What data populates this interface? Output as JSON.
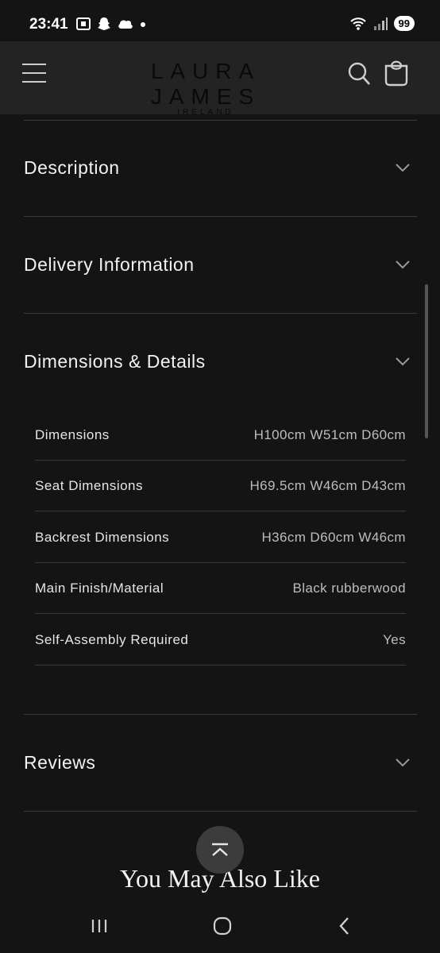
{
  "status_bar": {
    "time": "23:41",
    "battery": "99",
    "icons_left": [
      "screenshot-icon",
      "snapchat-icon",
      "cloud-icon",
      "dot-icon"
    ],
    "icons_right": [
      "wifi-icon",
      "signal-icon"
    ]
  },
  "header": {
    "logo_main": "LAURA JAMES",
    "logo_sub": "IRELAND",
    "icons": [
      "menu-icon",
      "search-icon",
      "cart-icon"
    ]
  },
  "accordions": [
    {
      "title": "Description",
      "expanded": false
    },
    {
      "title": "Delivery Information",
      "expanded": false
    },
    {
      "title": "Dimensions & Details",
      "expanded": true
    },
    {
      "title": "Reviews",
      "expanded": false
    }
  ],
  "details": [
    {
      "label": "Dimensions",
      "value": "H100cm W51cm D60cm"
    },
    {
      "label": "Seat Dimensions",
      "value": "H69.5cm W46cm D43cm"
    },
    {
      "label": "Backrest Dimensions",
      "value": "H36cm D60cm W46cm"
    },
    {
      "label": "Main Finish/Material",
      "value": "Black rubberwood"
    },
    {
      "label": "Self-Assembly Required",
      "value": "Yes"
    }
  ],
  "section_heading": "You May Also Like",
  "nav": [
    "recents-icon",
    "home-icon",
    "back-icon"
  ],
  "colors": {
    "background": "#141414",
    "header": "#232323",
    "divider": "#3a3a3a"
  }
}
